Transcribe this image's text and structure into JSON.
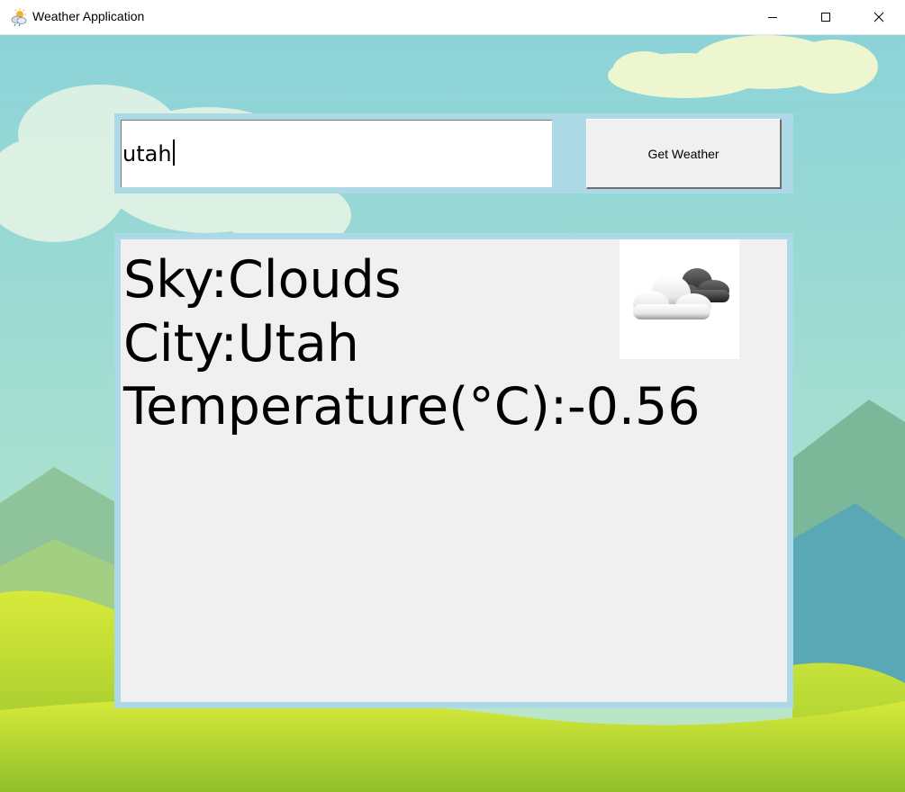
{
  "window": {
    "title": "Weather Application",
    "app_icon": "weather-app-icon",
    "controls": [
      "minimize-icon",
      "maximize-icon",
      "close-icon"
    ]
  },
  "search": {
    "value": "utah",
    "button_label": "Get Weather"
  },
  "result": {
    "sky": "Sky:Clouds",
    "city": "City:Utah",
    "temperature": "Temperature(°C):-0.56",
    "icon": "clouds-icon"
  },
  "colors": {
    "panel_border": "#add8e6",
    "panel_bg": "#f0f0f0",
    "sky": "#8fd4d6",
    "grass": "#c8e03a"
  }
}
